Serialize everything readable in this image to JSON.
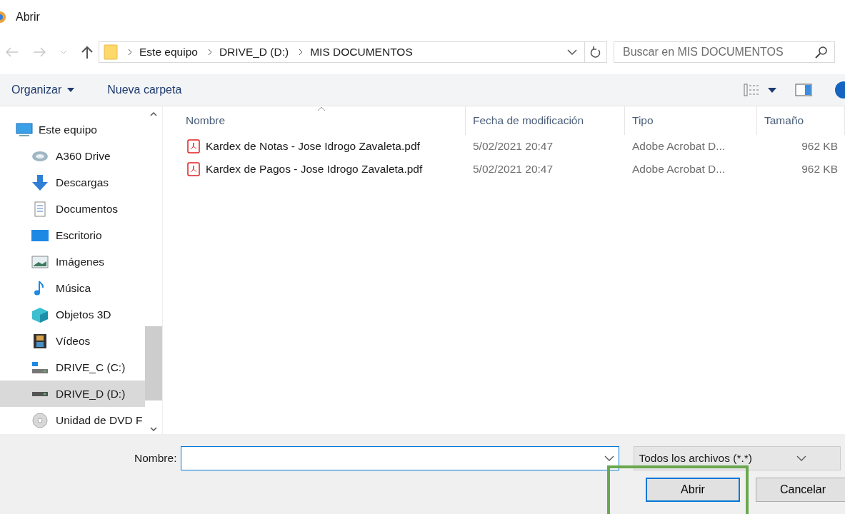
{
  "window": {
    "title": "Abrir"
  },
  "address": {
    "crumbs": [
      "Este equipo",
      "DRIVE_D (D:)",
      "MIS DOCUMENTOS"
    ]
  },
  "search": {
    "placeholder": "Buscar en MIS DOCUMENTOS"
  },
  "toolbar": {
    "organize": "Organizar",
    "new_folder": "Nueva carpeta"
  },
  "sidebar": {
    "items": [
      {
        "label": "Este equipo",
        "kind": "pc",
        "selected": false,
        "children": [
          {
            "label": "A360 Drive",
            "kind": "cloud",
            "selected": false
          },
          {
            "label": "Descargas",
            "kind": "download",
            "selected": false
          },
          {
            "label": "Documentos",
            "kind": "doc",
            "selected": false
          },
          {
            "label": "Escritorio",
            "kind": "desktop",
            "selected": false
          },
          {
            "label": "Imágenes",
            "kind": "image",
            "selected": false
          },
          {
            "label": "Música",
            "kind": "music",
            "selected": false
          },
          {
            "label": "Objetos 3D",
            "kind": "cube",
            "selected": false
          },
          {
            "label": "Vídeos",
            "kind": "video",
            "selected": false
          },
          {
            "label": "DRIVE_C (C:)",
            "kind": "sysdrive",
            "selected": false
          },
          {
            "label": "DRIVE_D (D:)",
            "kind": "drive",
            "selected": true
          },
          {
            "label": "Unidad de DVD F",
            "kind": "dvd",
            "selected": false
          }
        ]
      }
    ]
  },
  "table": {
    "columns": [
      "Nombre",
      "Fecha de modificación",
      "Tipo",
      "Tamaño"
    ],
    "rows": [
      {
        "name": "Kardex de Notas - Jose Idrogo Zavaleta.pdf",
        "date": "5/02/2021 20:47",
        "type": "Adobe Acrobat D...",
        "size": "962 KB"
      },
      {
        "name": "Kardex de Pagos - Jose Idrogo Zavaleta.pdf",
        "date": "5/02/2021 20:47",
        "type": "Adobe Acrobat D...",
        "size": "962 KB"
      }
    ]
  },
  "footer": {
    "name_label": "Nombre:",
    "filter": "Todos los archivos (*.*)",
    "buttons": [
      "Abrir",
      "Cancelar"
    ]
  }
}
